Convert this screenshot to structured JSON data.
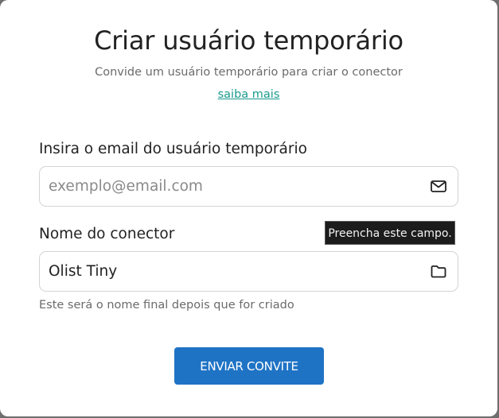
{
  "modal": {
    "title": "Criar usuário temporário",
    "subtitle": "Convide um usuário temporário para criar o conector",
    "learn_more_link": "saiba mais"
  },
  "email_field": {
    "label": "Insira o email do usuário temporário",
    "placeholder": "exemplo@email.com",
    "value": "",
    "icon": "envelope-icon"
  },
  "connector_field": {
    "label": "Nome do conector",
    "value": "Olist Tiny",
    "icon": "folder-icon",
    "helper": "Este será o nome final depois que for criado"
  },
  "tooltip": {
    "text": "Preencha este campo."
  },
  "submit_button": {
    "label": "ENVIAR CONVITE",
    "color": "#1f73c5"
  },
  "colors": {
    "link": "#1a9a8e",
    "overlay": "#6e6e6e"
  }
}
